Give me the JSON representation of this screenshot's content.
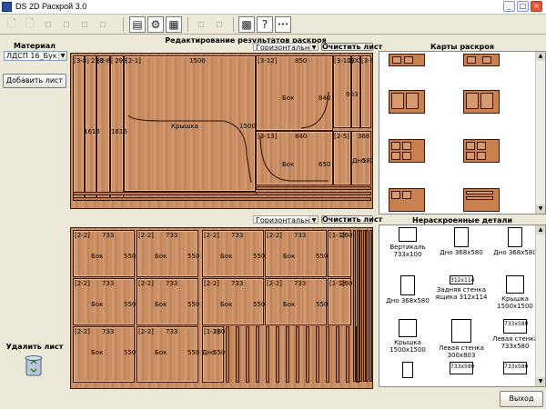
{
  "window": {
    "title": "DS 2D Раскрой 3.0",
    "minimize": "_",
    "maximize": "□",
    "close": "×"
  },
  "toolbar": {
    "help_glyph": "?",
    "more_glyph": "•••"
  },
  "left": {
    "material_label": "Материал",
    "material_value": "ЛДСП 16_Бук",
    "add_sheet": "Добавить лист",
    "delete_sheet": "Удалить лист"
  },
  "editor": {
    "title": "Редактирование результатов раскроя",
    "mode_top": "Горизонтальный рез",
    "mode_bottom": "Горизонтальный рез",
    "clear_top": "Очистить лист",
    "clear_bottom": "Очистить лист"
  },
  "maps": {
    "title": "Карты раскроя"
  },
  "uncut": {
    "title": "Нераскроенные детали",
    "items": [
      {
        "label": "Вертикаль 733х100",
        "inner": ""
      },
      {
        "label": "Дно 368х580",
        "inner": ""
      },
      {
        "label": "Дно 368х580",
        "inner": ""
      },
      {
        "label": "Дно 368х580",
        "inner": ""
      },
      {
        "label": "Задняя стенка ящика 312х114",
        "inner": "312х114"
      },
      {
        "label": "Крышка 1500х1500",
        "inner": ""
      },
      {
        "label": "Крышка 1500х1500",
        "inner": ""
      },
      {
        "label": "Левая стенка 300х803",
        "inner": ""
      },
      {
        "label": "Левая стенка 733х580",
        "inner": "733х580"
      },
      {
        "label": "",
        "inner": ""
      },
      {
        "label": "",
        "inner": "733х580"
      },
      {
        "label": "",
        "inner": "733х580"
      }
    ]
  },
  "exit": "Выход",
  "top_sheet": {
    "labels": [
      {
        "t": "[3-8] 298"
      },
      {
        "t": "[3-8] 298"
      },
      {
        "t": "[2-1]"
      },
      {
        "t": "1500"
      },
      {
        "t": "[3-12]"
      },
      {
        "t": "850"
      },
      {
        "t": "[3-10]"
      },
      {
        "t": "300"
      },
      {
        "t": "[3-6]"
      },
      {
        "t": "1616"
      },
      {
        "t": "1616"
      },
      {
        "t": "Крышка"
      },
      {
        "t": "1500"
      },
      {
        "t": "Бок"
      },
      {
        "t": "840"
      },
      {
        "t": "803"
      },
      {
        "t": "[3-13]"
      },
      {
        "t": "840"
      },
      {
        "t": "[2-5]"
      },
      {
        "t": "368"
      },
      {
        "t": "Бок"
      },
      {
        "t": "650"
      },
      {
        "t": "Дно"
      },
      {
        "t": "580"
      }
    ]
  },
  "bottom_sheet": {
    "labels": [
      {
        "t": "[2-2]"
      },
      {
        "t": "733"
      },
      {
        "t": "Бок"
      },
      {
        "t": "550"
      },
      {
        "t": "[2-2]"
      },
      {
        "t": "733"
      },
      {
        "t": "Бок"
      },
      {
        "t": "550"
      },
      {
        "t": "[2-2]"
      },
      {
        "t": "733"
      },
      {
        "t": "Бок"
      },
      {
        "t": "550"
      },
      {
        "t": "[2-2]"
      },
      {
        "t": "733"
      },
      {
        "t": "Бок"
      },
      {
        "t": "550"
      },
      {
        "t": "[1-1]"
      },
      {
        "t": "260"
      },
      {
        "t": "[2-2]"
      },
      {
        "t": "733"
      },
      {
        "t": "Бок"
      },
      {
        "t": "550"
      },
      {
        "t": "[2-2]"
      },
      {
        "t": "733"
      },
      {
        "t": "Бок"
      },
      {
        "t": "550"
      },
      {
        "t": "[2-2]"
      },
      {
        "t": "733"
      },
      {
        "t": "Бок"
      },
      {
        "t": "550"
      },
      {
        "t": "[2-2]"
      },
      {
        "t": "733"
      },
      {
        "t": "Бок"
      },
      {
        "t": "550"
      },
      {
        "t": "[1-1]"
      },
      {
        "t": "260"
      },
      {
        "t": "[2-2]"
      },
      {
        "t": "733"
      },
      {
        "t": "Бок"
      },
      {
        "t": "550"
      },
      {
        "t": "[2-2]"
      },
      {
        "t": "733"
      },
      {
        "t": "Бок"
      },
      {
        "t": "550"
      },
      {
        "t": "[1-1]"
      },
      {
        "t": "280"
      },
      {
        "t": "Дно"
      },
      {
        "t": "550"
      }
    ]
  }
}
